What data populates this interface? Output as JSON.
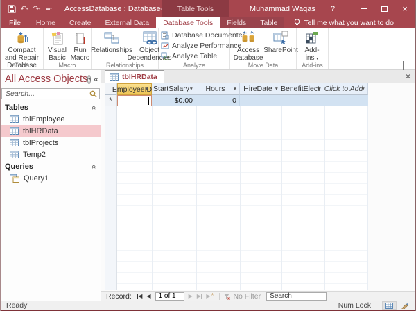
{
  "titlebar": {
    "title": "AccessDatabase : Database- C:\\Users\\Mu...",
    "contextual_tools": "Table Tools",
    "user_name": "Muhammad Waqas",
    "help": "?"
  },
  "tabs": {
    "file": "File",
    "home": "Home",
    "create": "Create",
    "external_data": "External Data",
    "database_tools": "Database Tools",
    "fields": "Fields",
    "table": "Table",
    "tell_me": "Tell me what you want to do"
  },
  "ribbon": {
    "groups": {
      "tools": {
        "label": "Tools",
        "compact": "Compact and Repair Database"
      },
      "macro": {
        "label": "Macro",
        "visual_basic": "Visual Basic",
        "run_macro": "Run Macro"
      },
      "relationships": {
        "label": "Relationships",
        "relationships": "Relationships",
        "object_dependencies": "Object Dependencies"
      },
      "analyze": {
        "label": "Analyze",
        "items": [
          "Database Documenter",
          "Analyze Performance",
          "Analyze Table"
        ]
      },
      "move_data": {
        "label": "Move Data",
        "access_database": "Access Database",
        "sharepoint": "SharePoint"
      },
      "addins": {
        "label": "Add-ins",
        "button": "Add-ins"
      }
    }
  },
  "nav_pane": {
    "title": "All Access Objects",
    "search_placeholder": "Search...",
    "tables_label": "Tables",
    "tables": [
      {
        "name": "tblEmployee"
      },
      {
        "name": "tblHRData"
      },
      {
        "name": "tblProjects"
      },
      {
        "name": "Temp2"
      }
    ],
    "queries_label": "Queries",
    "queries": [
      {
        "name": "Query1"
      }
    ]
  },
  "document": {
    "tab_title": "tblHRData",
    "columns": [
      "EmployeeID",
      "StartSalary",
      "Hours",
      "HireDate",
      "BenefitElect",
      "Click to Add"
    ],
    "new_record": {
      "start_salary": "$0.00",
      "hours": "0"
    }
  },
  "record_nav": {
    "label": "Record:",
    "position": "1 of 1",
    "no_filter": "No Filter",
    "search": "Search"
  },
  "status": {
    "left": "Ready",
    "num_lock": "Num Lock"
  },
  "colors": {
    "accent_red": "#a7464e",
    "contextual_red": "#8c3a43",
    "selected_header_gold": "#eec453",
    "nav_selection_pink": "#f5c9cd",
    "row_highlight_blue": "#d2e2f2"
  }
}
